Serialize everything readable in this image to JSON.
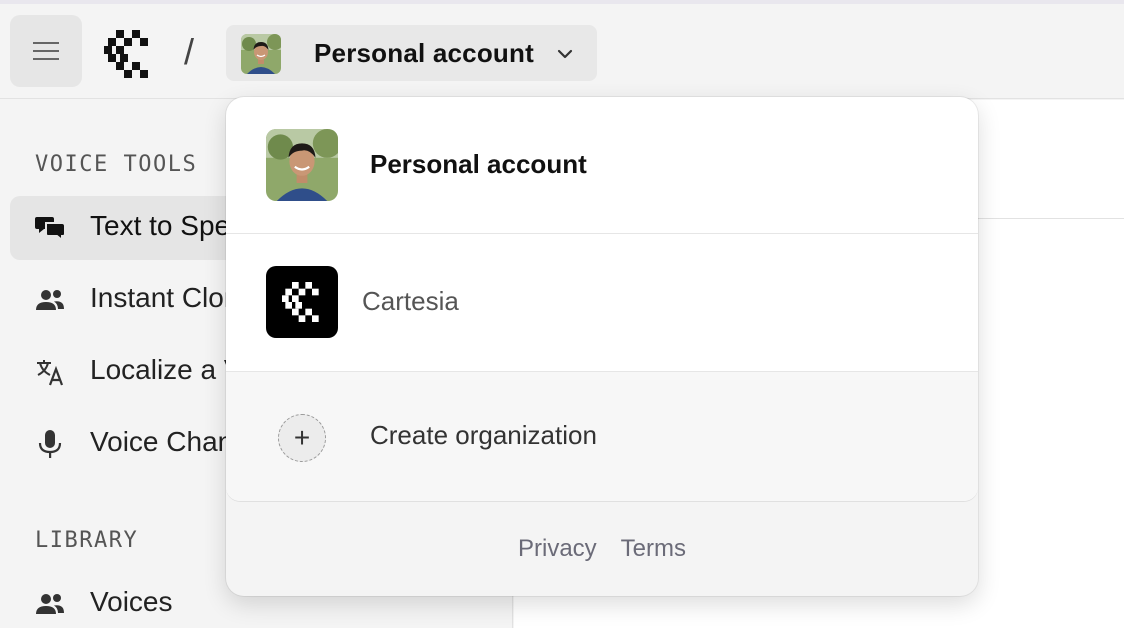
{
  "header": {
    "separator": "/",
    "account_selector": {
      "label": "Personal account"
    }
  },
  "sidebar": {
    "sections": [
      {
        "title": "VOICE TOOLS",
        "items": [
          {
            "label": "Text to Speech",
            "icon": "chat-bubbles-icon",
            "active": true
          },
          {
            "label": "Instant Clone",
            "icon": "people-icon"
          },
          {
            "label": "Localize a Voice",
            "icon": "translate-icon"
          },
          {
            "label": "Voice Changer",
            "icon": "microphone-icon"
          }
        ]
      },
      {
        "title": "LIBRARY",
        "items": [
          {
            "label": "Voices",
            "icon": "people-icon"
          }
        ]
      }
    ]
  },
  "dropdown": {
    "accounts": [
      {
        "name": "Personal account",
        "type": "personal"
      },
      {
        "name": "Cartesia",
        "type": "organization"
      }
    ],
    "create_label": "Create organization",
    "footer": {
      "privacy": "Privacy",
      "terms": "Terms"
    }
  },
  "colors": {
    "accent": "#000000",
    "muted": "#6b6b78"
  }
}
